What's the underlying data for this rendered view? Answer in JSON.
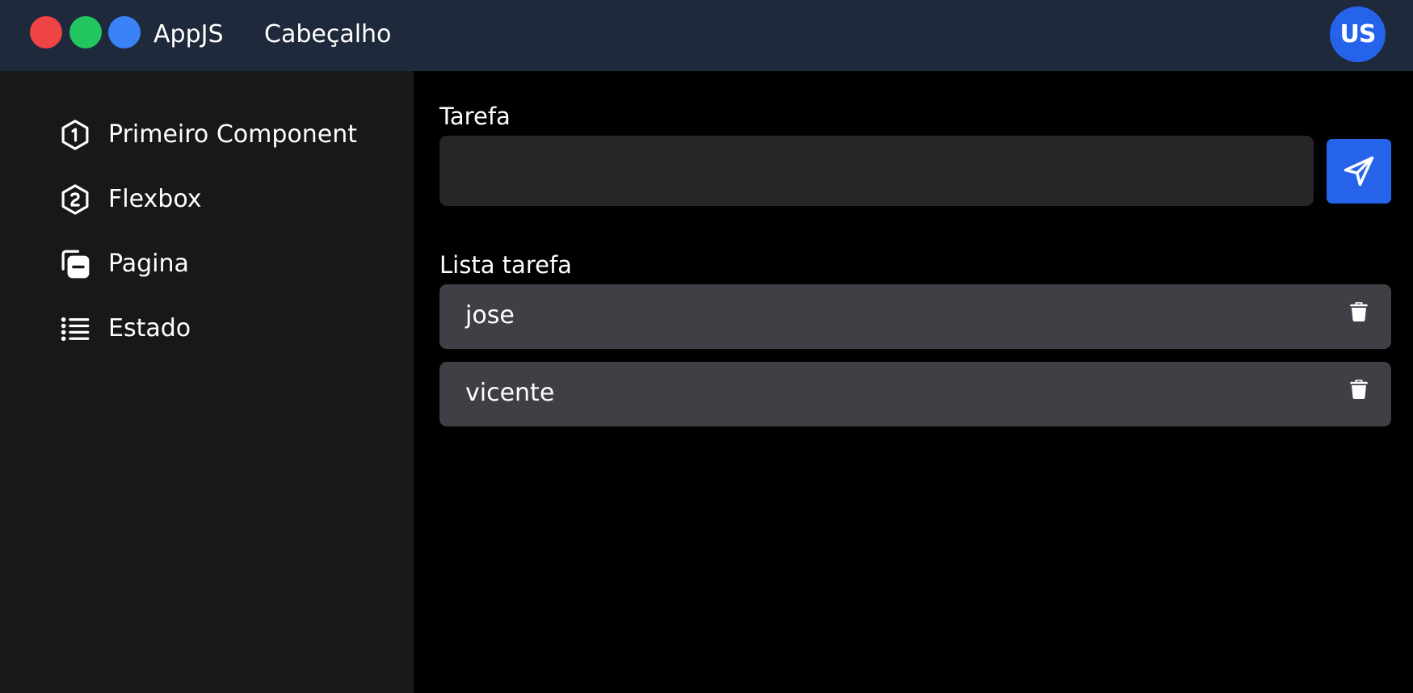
{
  "header": {
    "app_title": "AppJS",
    "nav_label": "Cabeçalho",
    "avatar_initials": "US",
    "window_dots": [
      "red",
      "green",
      "blue"
    ]
  },
  "sidebar": {
    "items": [
      {
        "label": "Primeiro Component",
        "icon": "hexagon-number-1-icon"
      },
      {
        "label": "Flexbox",
        "icon": "hexagon-number-2-icon"
      },
      {
        "label": "Pagina",
        "icon": "copy-minus-icon"
      },
      {
        "label": "Estado",
        "icon": "list-icon"
      }
    ]
  },
  "main": {
    "task_label": "Tarefa",
    "task_input_value": "",
    "task_input_placeholder": "",
    "send_icon": "send-icon",
    "list_label": "Lista tarefa",
    "tasks": [
      {
        "text": "jose",
        "icon": "trash-icon"
      },
      {
        "text": "vicente",
        "icon": "trash-icon"
      }
    ]
  },
  "colors": {
    "header_bg": "#1e293b",
    "sidebar_bg": "#18181b",
    "main_bg": "#000000",
    "input_bg": "#262626",
    "task_bg": "#3f3f46",
    "accent": "#2563eb",
    "dot_red": "#ef4444",
    "dot_green": "#22c55e",
    "dot_blue": "#3b82f6"
  }
}
